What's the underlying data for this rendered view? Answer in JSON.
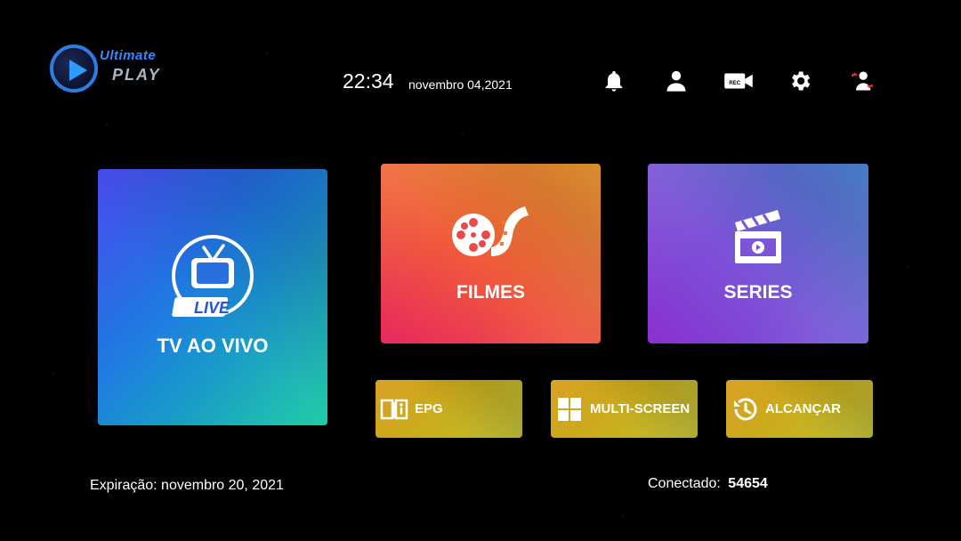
{
  "logo": {
    "line1": "Ultimate",
    "line2": "PLAY"
  },
  "header": {
    "time": "22:34",
    "date": "novembro 04,2021"
  },
  "top_icons": [
    "bell-icon",
    "user-icon",
    "rec-camera-icon",
    "gear-icon",
    "switch-user-icon"
  ],
  "rec_badge": "REC",
  "tiles": {
    "live": {
      "label": "TV AO VIVO",
      "badge": "LIVE"
    },
    "filmes": {
      "label": "FILMES"
    },
    "series": {
      "label": "SERIES"
    },
    "epg": {
      "label": "EPG"
    },
    "multi": {
      "label": "MULTI-SCREEN"
    },
    "alcancar": {
      "label": "ALCANÇAR"
    }
  },
  "footer": {
    "expiration": "Expiração: novembro 20, 2021",
    "connected_label": "Conectado:",
    "connected_value": "54654"
  },
  "colors": {
    "live_gradient": [
      "#3a3ef0",
      "#10c9a0"
    ],
    "filmes_gradient": [
      "#e8285e",
      "#f6a131"
    ],
    "series_gradient": [
      "#8b2fd0",
      "#4d8ce0"
    ],
    "small_tile": "#d59a14"
  }
}
